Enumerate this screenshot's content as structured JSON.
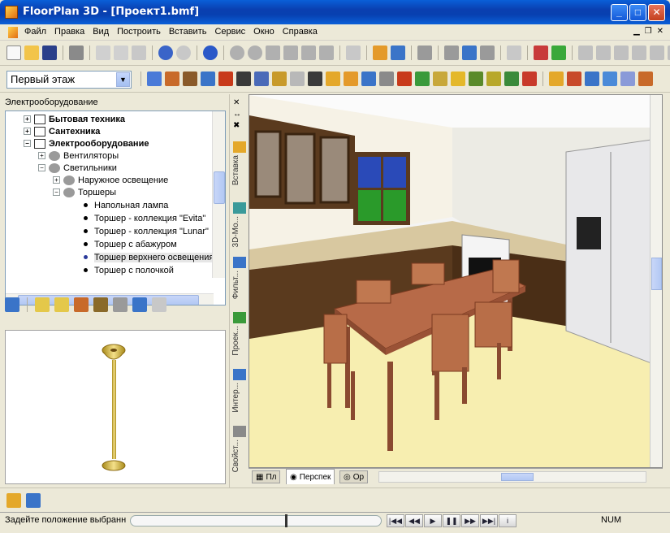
{
  "window": {
    "title": "FloorPlan 3D - [Проект1.bmf]",
    "min": "_",
    "max": "□",
    "close": "✕"
  },
  "menu": [
    "Файл",
    "Правка",
    "Вид",
    "Построить",
    "Вставить",
    "Сервис",
    "Окно",
    "Справка"
  ],
  "floor_select": {
    "value": "Первый этаж"
  },
  "catalog": {
    "label": "Электрооборудование",
    "tree": [
      {
        "label": "Бытовая техника"
      },
      {
        "label": "Сантехника"
      },
      {
        "label": "Электрооборудование"
      },
      {
        "label": "Вентиляторы"
      },
      {
        "label": "Светильники"
      },
      {
        "label": "Наружное освещение"
      },
      {
        "label": "Торшеры"
      },
      {
        "label": "Напольная лампа"
      },
      {
        "label": "Торшер - коллекция \"Evita\""
      },
      {
        "label": "Торшер - коллекция \"Lunar\""
      },
      {
        "label": "Торшер с абажуром"
      },
      {
        "label": "Торшер верхнего освещения"
      },
      {
        "label": "Торшер с полочкой"
      }
    ]
  },
  "side_tabs": [
    "Вставка",
    "3D-Мо...",
    "Фильт...",
    "Проек...",
    "Интер...",
    "Свойст..."
  ],
  "view_tabs": [
    "Пл",
    "Перспек",
    "Ор"
  ],
  "status": {
    "message": "Задейте положение выбранн",
    "indicator": "NUM"
  },
  "colors": {
    "title_bar": "#0a3fb0",
    "floor": "#f7eeb0",
    "wall": "#f6f2e6",
    "cabinet": "#5a3a1e",
    "table": "#b76a48",
    "fridge": "#e8e8ea"
  }
}
